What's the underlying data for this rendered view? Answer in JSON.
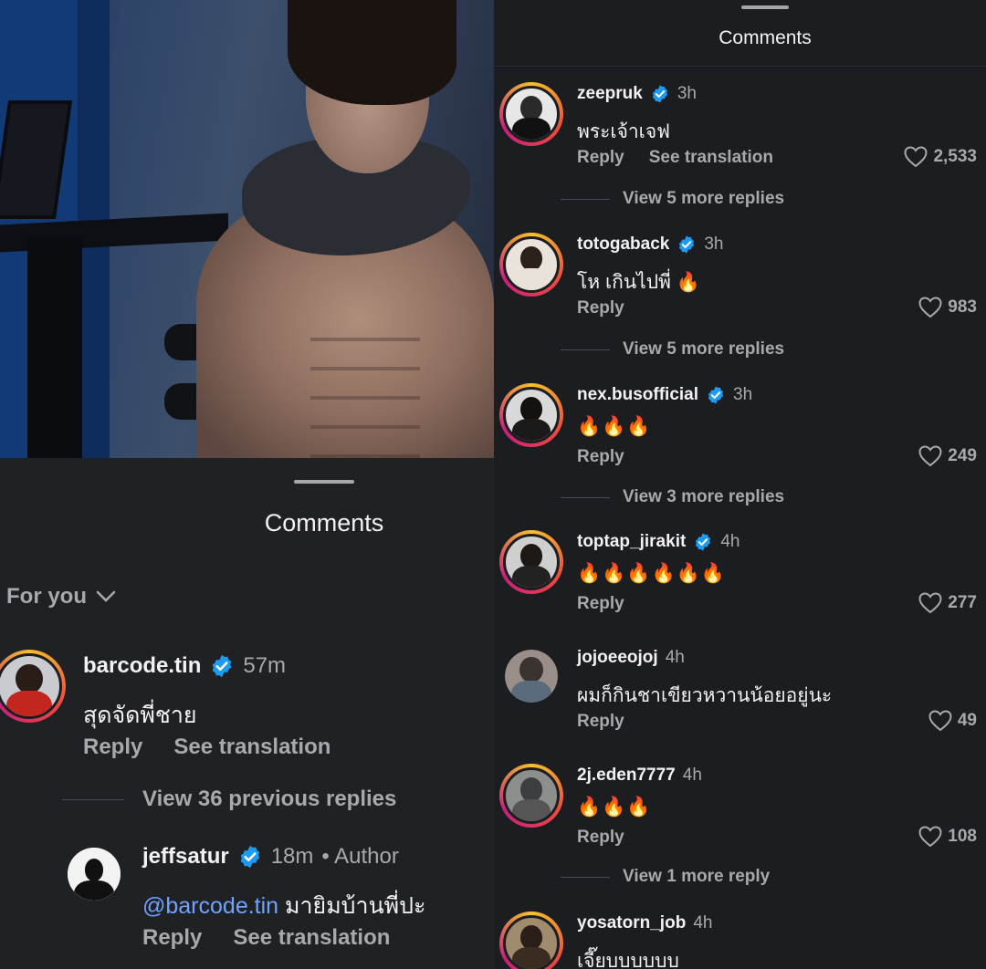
{
  "left_panel": {
    "sheet_title": "Comments",
    "sort_label": "For you",
    "comments": [
      {
        "username": "barcode.tin",
        "time": "57m",
        "text": "สุดจัดพี่ชาย",
        "reply_label": "Reply",
        "translate_label": "See translation"
      }
    ],
    "view_previous": "View 36 previous replies",
    "reply": {
      "username": "jeffsatur",
      "time": "18m",
      "author_tag": "• Author",
      "mention": "@barcode.tin",
      "text": " มายิมบ้านพี่ปะ",
      "reply_label": "Reply",
      "translate_label": "See translation"
    }
  },
  "right_panel": {
    "sheet_title": "Comments",
    "comments": [
      {
        "username": "zeepruk",
        "verified": true,
        "time": "3h",
        "text": "พระเจ้าเจฟ",
        "reply_label": "Reply",
        "translate_label": "See translation",
        "likes": "2,533",
        "view_more": "View 5 more replies"
      },
      {
        "username": "totogaback",
        "verified": true,
        "time": "3h",
        "text": "โห เกินไปพี่ 🔥",
        "reply_label": "Reply",
        "likes": "983",
        "view_more": "View 5 more replies"
      },
      {
        "username": "nex.busofficial",
        "verified": true,
        "time": "3h",
        "text": "🔥🔥🔥",
        "reply_label": "Reply",
        "likes": "249",
        "view_more": "View 3 more replies"
      },
      {
        "username": "toptap_jirakit",
        "verified": true,
        "time": "4h",
        "text": "🔥🔥🔥🔥🔥🔥",
        "reply_label": "Reply",
        "likes": "277"
      },
      {
        "username": "jojoeeojoj",
        "verified": false,
        "time": "4h",
        "text": "ผมก็กินชาเขียวหวานน้อยอยู่นะ",
        "reply_label": "Reply",
        "likes": "49"
      },
      {
        "username": "2j.eden7777",
        "verified": false,
        "time": "4h",
        "text": "🔥🔥🔥",
        "reply_label": "Reply",
        "likes": "108",
        "view_more": "View 1 more reply"
      },
      {
        "username": "yosatorn_job",
        "verified": false,
        "time": "4h",
        "text": "เจี๊ยบบบบบบ"
      }
    ]
  },
  "colors": {
    "background": "#1c1d21",
    "text_primary": "#f2f2f2",
    "text_secondary": "#a7a9ad",
    "verified_blue": "#1d9bf0",
    "mention_blue": "#6ea3ff",
    "story_ring": [
      "#f6c02b",
      "#ee4a3c",
      "#c4207d"
    ]
  },
  "icons": {
    "verified": "verified-badge-icon",
    "like": "heart-outline-icon",
    "sort": "chevron-down-icon"
  }
}
